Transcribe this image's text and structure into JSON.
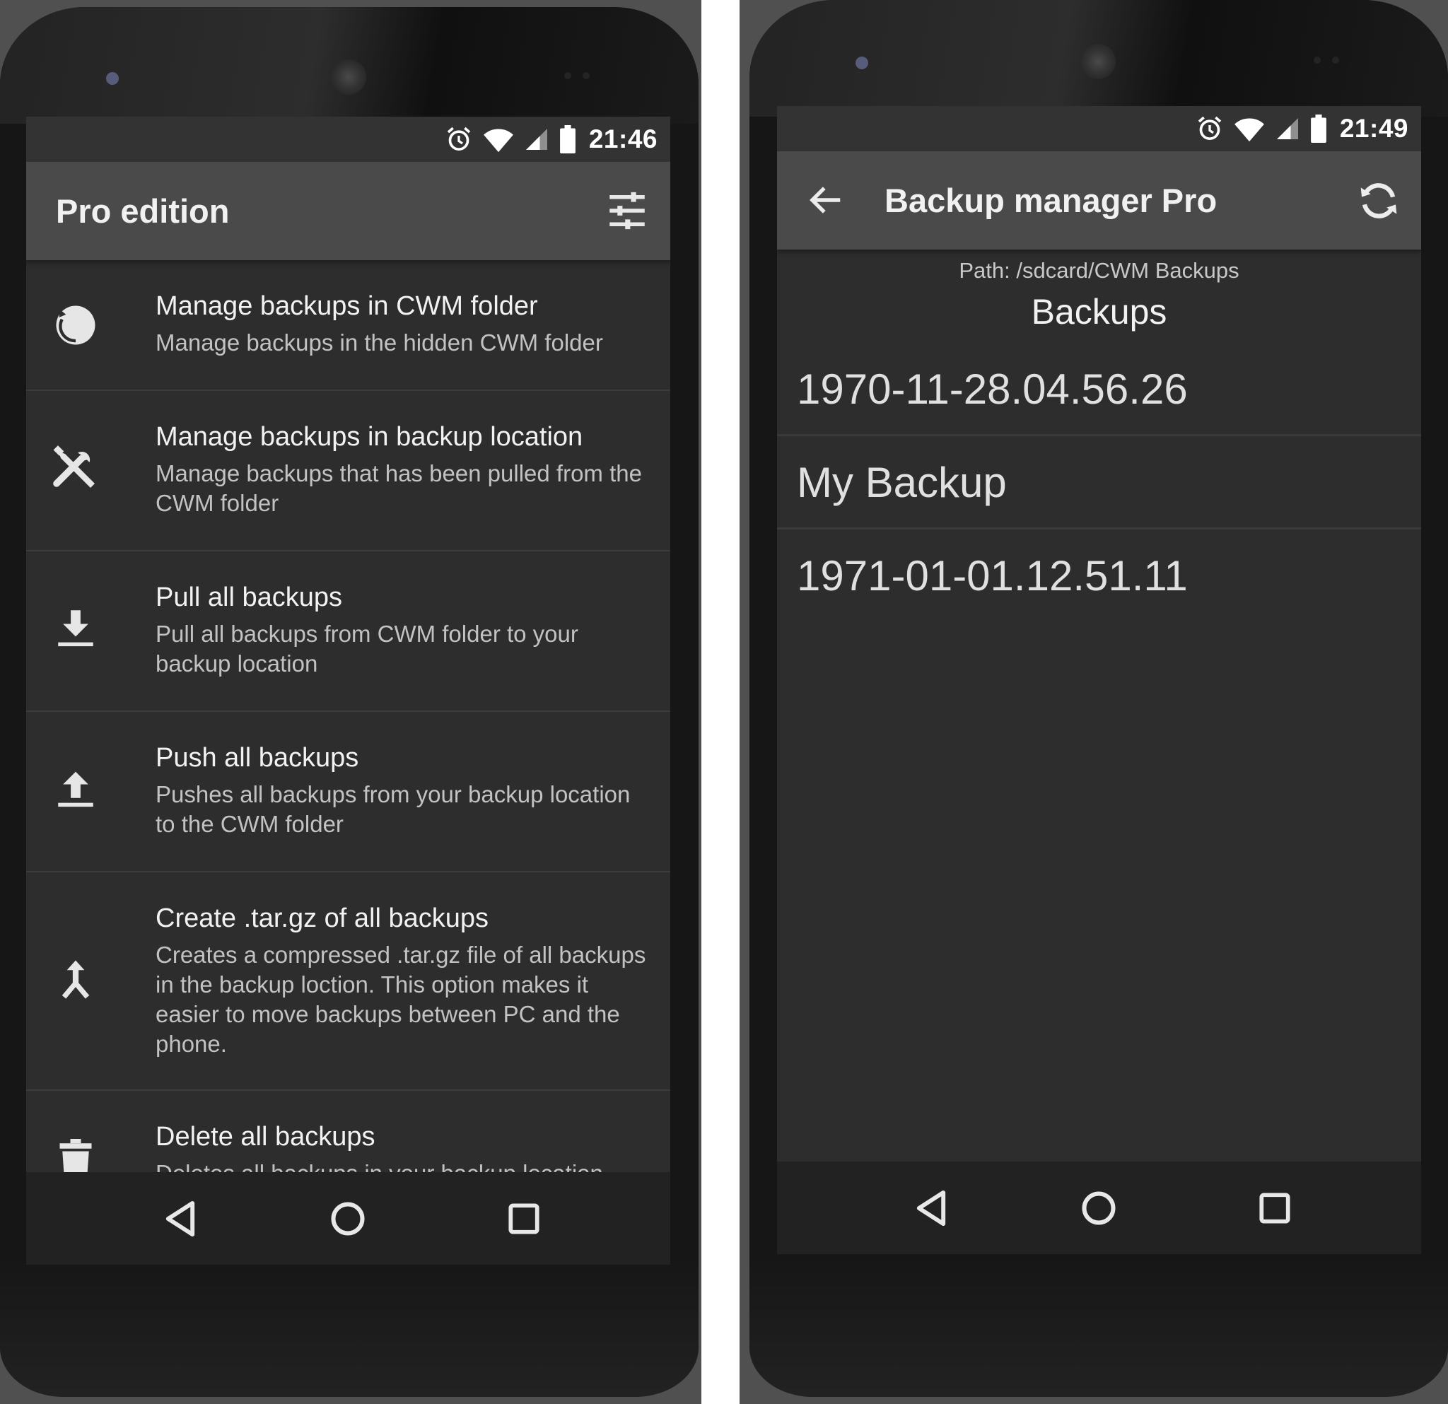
{
  "left_screen": {
    "status": {
      "time": "21:46"
    },
    "appbar": {
      "title": "Pro edition",
      "action_icon": "tune-sliders-icon"
    },
    "menu_items": [
      {
        "icon": "restore-circle-icon",
        "title": "Manage backups in CWM folder",
        "subtitle": "Manage backups in the hidden CWM folder"
      },
      {
        "icon": "tools-icon",
        "title": "Manage backups in backup location",
        "subtitle": "Manage backups that has been pulled from the CWM folder"
      },
      {
        "icon": "download-icon",
        "title": "Pull all backups",
        "subtitle": "Pull all backups from CWM folder to your backup location"
      },
      {
        "icon": "upload-icon",
        "title": "Push all backups",
        "subtitle": "Pushes all backups from your backup location to the CWM folder"
      },
      {
        "icon": "merge-icon",
        "title": "Create .tar.gz of all backups",
        "subtitle": "Creates a compressed .tar.gz file of all backups in the backup loction. This option makes it easier to move backups between PC and the phone."
      },
      {
        "icon": "trash-icon",
        "title": "Delete all backups",
        "subtitle": "Deletes all backups in your backup location"
      }
    ]
  },
  "right_screen": {
    "status": {
      "time": "21:49"
    },
    "appbar": {
      "title": "Backup manager Pro",
      "back_icon": "arrow-back-icon",
      "action_icon": "refresh-icon"
    },
    "path": "Path: /sdcard/CWM Backups",
    "section_title": "Backups",
    "backups": [
      "1970-11-28.04.56.26",
      "My Backup",
      "1971-01-01.12.51.11"
    ]
  },
  "colors": {
    "screen_bg": "#2d2d2d",
    "appbar_bg": "#4a4a4a",
    "statusbar_bg": "#333333",
    "navbar_bg": "#222222",
    "text_primary": "#f2f2f2",
    "text_secondary": "#c2c2c2"
  }
}
